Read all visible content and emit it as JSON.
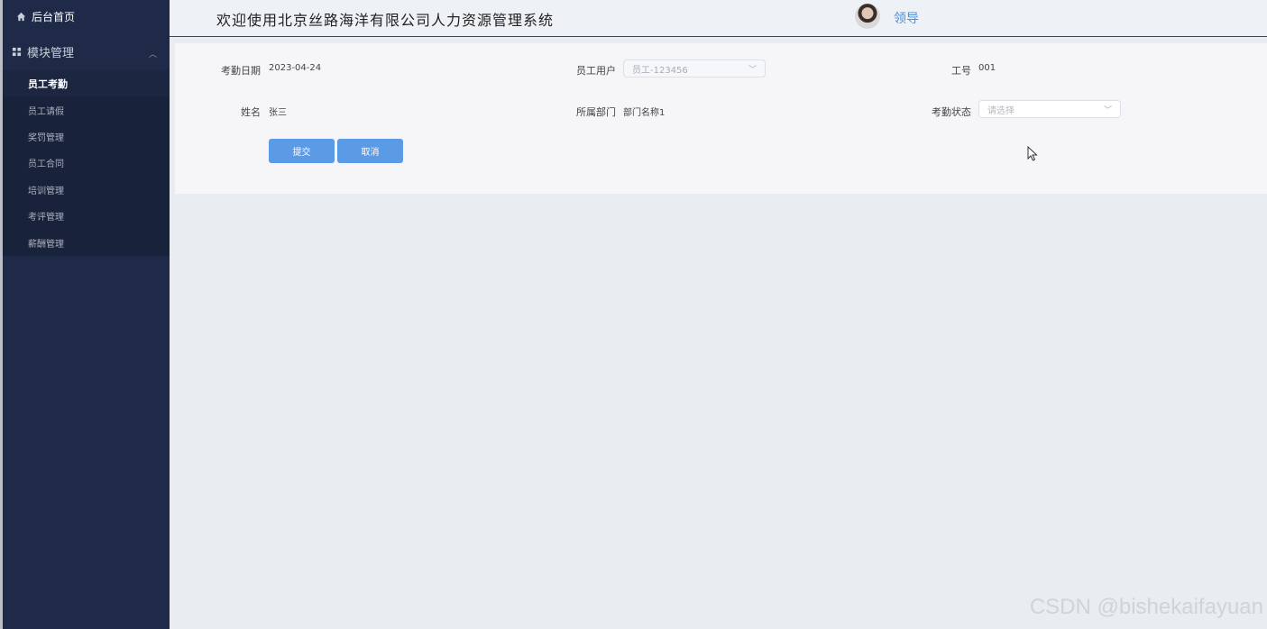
{
  "header": {
    "title": "欢迎使用北京丝路海洋有限公司人力资源管理系统",
    "username": "领导"
  },
  "sidebar": {
    "home_label": "后台首页",
    "group_label": "模块管理",
    "items": [
      {
        "label": "员工考勤",
        "active": true
      },
      {
        "label": "员工请假"
      },
      {
        "label": "奖罚管理"
      },
      {
        "label": "员工合同"
      },
      {
        "label": "培训管理"
      },
      {
        "label": "考评管理"
      },
      {
        "label": "薪酬管理"
      }
    ]
  },
  "form": {
    "date_label": "考勤日期",
    "date_value": "2023-04-24",
    "employee_label": "员工用户",
    "employee_value": "员工-123456",
    "empno_label": "工号",
    "empno_value": "001",
    "name_label": "姓名",
    "name_value": "张三",
    "dept_label": "所属部门",
    "dept_value": "部门名称1",
    "status_label": "考勤状态",
    "status_placeholder": "请选择",
    "submit_label": "提交",
    "cancel_label": "取消"
  },
  "watermark": "CSDN @bishekaifayuan",
  "colors": {
    "sidebar_bg": "#1e2a47",
    "accent": "#5b9be6",
    "username": "#4a8fd8"
  }
}
